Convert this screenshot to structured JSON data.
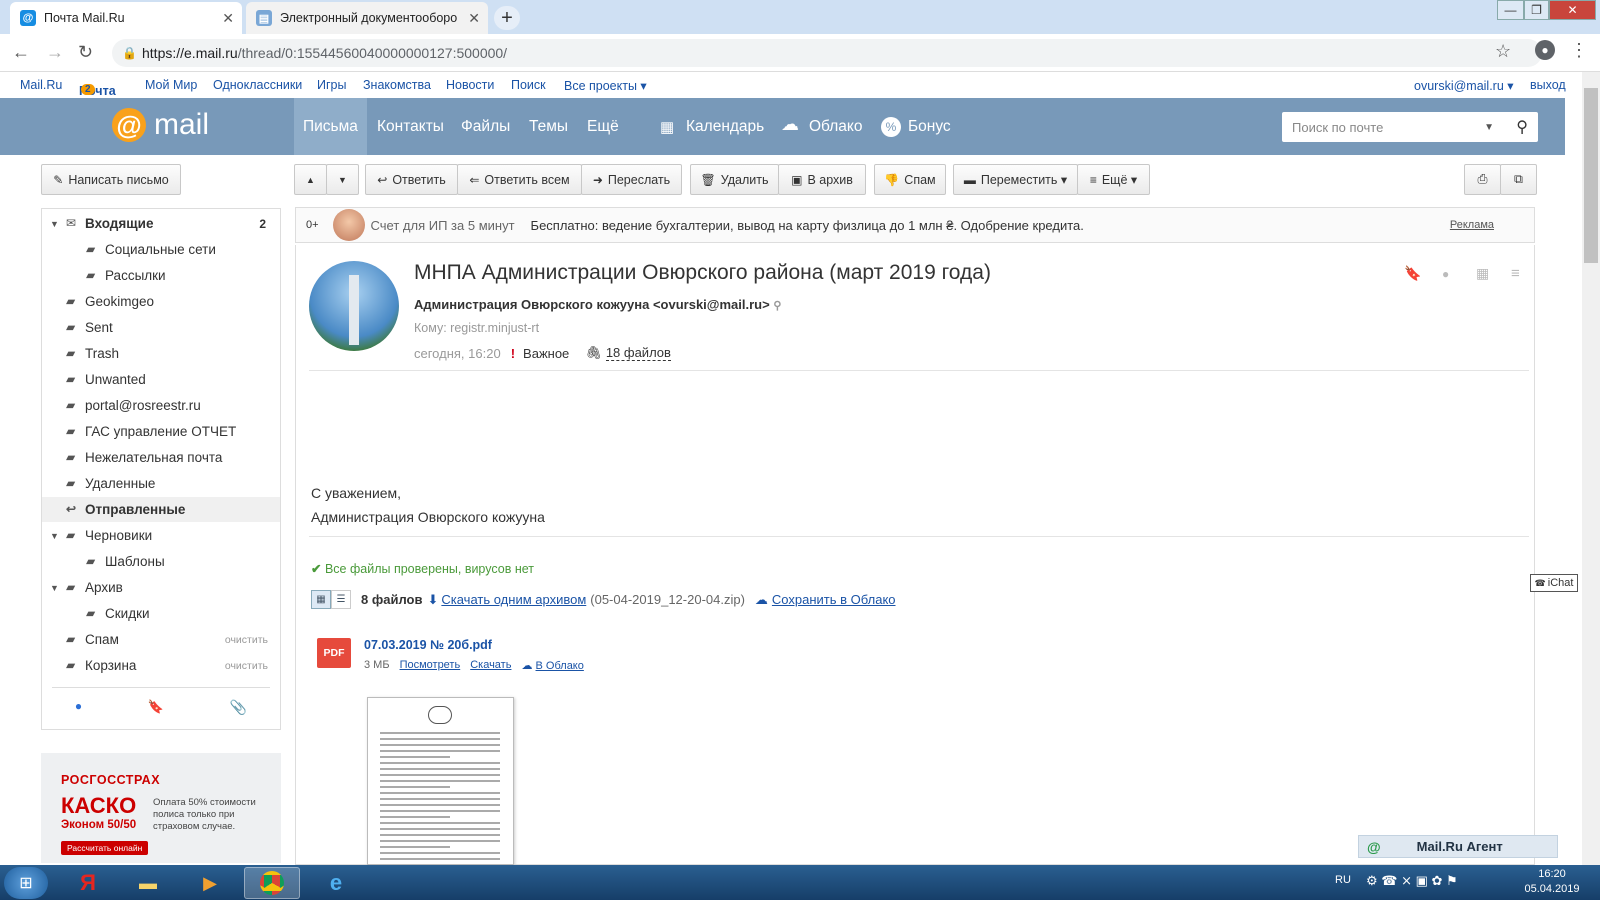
{
  "browser": {
    "tabs": [
      {
        "label": "Почта Mail.Ru",
        "active": true
      },
      {
        "label": "Электронный документооборо",
        "active": false
      }
    ],
    "url_host": "https://e.mail.ru",
    "url_path": "/thread/0:15544560040000000127:500000/"
  },
  "toplinks": {
    "items": [
      "Mail.Ru",
      "Почта",
      "Мой Мир",
      "Одноклассники",
      "Игры",
      "Знакомства",
      "Новости",
      "Поиск",
      "Все проекты ▾"
    ],
    "pochta_badge": "2",
    "user": "ovurski@mail.ru ▾",
    "logout": "выход"
  },
  "header": {
    "logo_text": "mail",
    "nav": [
      "Письма",
      "Контакты",
      "Файлы",
      "Темы",
      "Ещё"
    ],
    "services": [
      "Календарь",
      "Облако",
      "Бонус"
    ],
    "search_placeholder": "Поиск по почте",
    "accent": "#7899b9"
  },
  "toolbar": {
    "compose": "Написать письмо",
    "reply": "Ответить",
    "reply_all": "Ответить всем",
    "forward": "Переслать",
    "delete": "Удалить",
    "archive": "В архив",
    "spam": "Спам",
    "move": "Переместить ▾",
    "more": "Ещё ▾"
  },
  "sidebar": {
    "folders": [
      {
        "label": "Входящие",
        "count": "2",
        "bold": true,
        "arrow": true,
        "indent": 0
      },
      {
        "label": "Социальные сети",
        "indent": 1
      },
      {
        "label": "Рассылки",
        "indent": 1
      },
      {
        "label": "Geokimgeo",
        "indent": 0
      },
      {
        "label": "Sent",
        "indent": 0
      },
      {
        "label": "Trash",
        "indent": 0
      },
      {
        "label": "Unwanted",
        "indent": 0
      },
      {
        "label": "portal@rosreestr.ru",
        "indent": 0
      },
      {
        "label": "ГАС управление ОТЧЕТ",
        "indent": 0
      },
      {
        "label": "Нежелательная почта",
        "indent": 0
      },
      {
        "label": "Удаленные",
        "indent": 0
      },
      {
        "label": "Отправленные",
        "indent": 0,
        "selected": true
      },
      {
        "label": "Черновики",
        "arrow": true,
        "indent": 0
      },
      {
        "label": "Шаблоны",
        "indent": 1
      },
      {
        "label": "Архив",
        "arrow": true,
        "indent": 0
      },
      {
        "label": "Скидки",
        "indent": 1
      },
      {
        "label": "Спам",
        "clear": "очистить",
        "indent": 0
      },
      {
        "label": "Корзина",
        "clear": "очистить",
        "indent": 0
      }
    ]
  },
  "ad_banner": {
    "brand": "РОСГОССТРАХ",
    "product": "КАСКО",
    "sub": "Эконом 50/50",
    "text": "Оплата 50% стоимости полиса только при страховом случае.",
    "cta": "Рассчитать онлайн"
  },
  "adline": {
    "age": "0+",
    "title": "Счет для ИП за 5 минут",
    "text": "Бесплатно: ведение бухгалтерии, вывод на карту физлица до 1 млн ₴. Одобрение кредита.",
    "label": "Реклама"
  },
  "message": {
    "subject": "МНПА Администрации Овюрского района (март 2019 года)",
    "from": "Администрация Овюрского кожууна <ovurski@mail.ru>",
    "to": "Кому: registr.minjust-rt",
    "date": "сегодня, 16:20",
    "important": "Важное",
    "files_link": "18 файлов",
    "body_line1": "С уважением,",
    "body_line2": "Администрация Овюрского кожууна",
    "virus_check": "Все файлы проверены, вирусов нет",
    "files_count": "8 файлов",
    "download_all": "Скачать одним архивом",
    "archive_name": "(05-04-2019_12-20-04.zip)",
    "save_cloud": "Сохранить в Облако",
    "attachment": {
      "name": "07.03.2019 № 20б.pdf",
      "type": "PDF",
      "size": "3 МБ",
      "view": "Посмотреть",
      "download": "Скачать",
      "cloud": "В Облако"
    }
  },
  "chat_label": "iChat",
  "agent_label": "Mail.Ru Агент",
  "taskbar": {
    "lang": "RU",
    "time": "16:20",
    "date": "05.04.2019"
  }
}
